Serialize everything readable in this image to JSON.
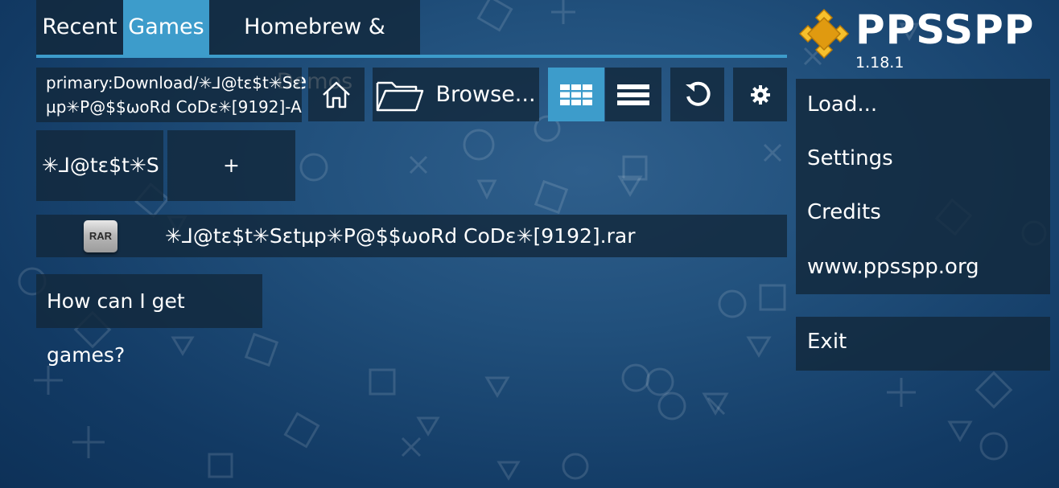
{
  "tabs": [
    {
      "label": "Recent"
    },
    {
      "label": "Games",
      "selected": true
    },
    {
      "label": "Homebrew & Demos"
    }
  ],
  "toolbar": {
    "path_line1": "primary:Download/✳︎⅃@tɛ$t✳︎Sɛt",
    "path_line2": "µp✳︎P@$$ωoRd CoDɛ✳︎[9192]-A",
    "browse_label": "Browse...",
    "home_icon": "home-icon",
    "folder_icon": "folder-icon",
    "grid_icon": "grid-view-icon",
    "list_icon": "list-view-icon",
    "refresh_icon": "refresh-icon",
    "settings_icon": "gear-icon"
  },
  "grid": {
    "folder_label": "✳︎⅃@tɛ$t✳︎S",
    "add_label": "+"
  },
  "file": {
    "icon_text": "RAR",
    "name": "✳︎⅃@tɛ$t✳︎Sɛtµp✳︎P@$$ωoRd CoDɛ✳︎[9192].rar"
  },
  "howto_label": "How can I get games?",
  "brand": {
    "name": "PPSSPP",
    "version": "1.18.1",
    "logo_colors": [
      "#f6c02c",
      "#e09a10"
    ]
  },
  "menu": [
    {
      "label": "Load..."
    },
    {
      "label": "Settings"
    },
    {
      "label": "Credits"
    },
    {
      "label": "www.ppsspp.org"
    }
  ],
  "exit_label": "Exit",
  "colors": {
    "accent": "#3d9ccb",
    "panel": "#12283c"
  }
}
